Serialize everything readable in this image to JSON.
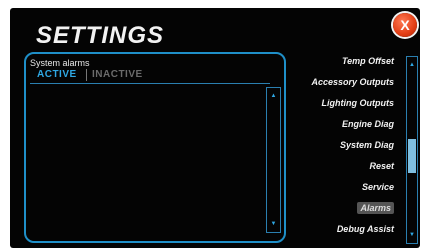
{
  "header": {
    "title": "SETTINGS",
    "close_label": "X"
  },
  "alarm_panel": {
    "label": "System alarms",
    "tabs": [
      {
        "label": "ACTIVE",
        "active": true
      },
      {
        "label": "INACTIVE",
        "active": false
      }
    ],
    "scroll_up": "▲",
    "scroll_down": "▼"
  },
  "menu": {
    "items": [
      {
        "label": "Temp Offset"
      },
      {
        "label": "Accessory Outputs"
      },
      {
        "label": "Lighting Outputs"
      },
      {
        "label": "Engine Diag"
      },
      {
        "label": "System Diag"
      },
      {
        "label": "Reset"
      },
      {
        "label": "Service"
      },
      {
        "label": "Alarms",
        "selected": true
      },
      {
        "label": "Debug Assist"
      }
    ],
    "scroll_up": "▲",
    "scroll_down": "▼"
  },
  "colors": {
    "accent": "#2fa8e4",
    "close": "#e23d14",
    "background": "#040404"
  }
}
